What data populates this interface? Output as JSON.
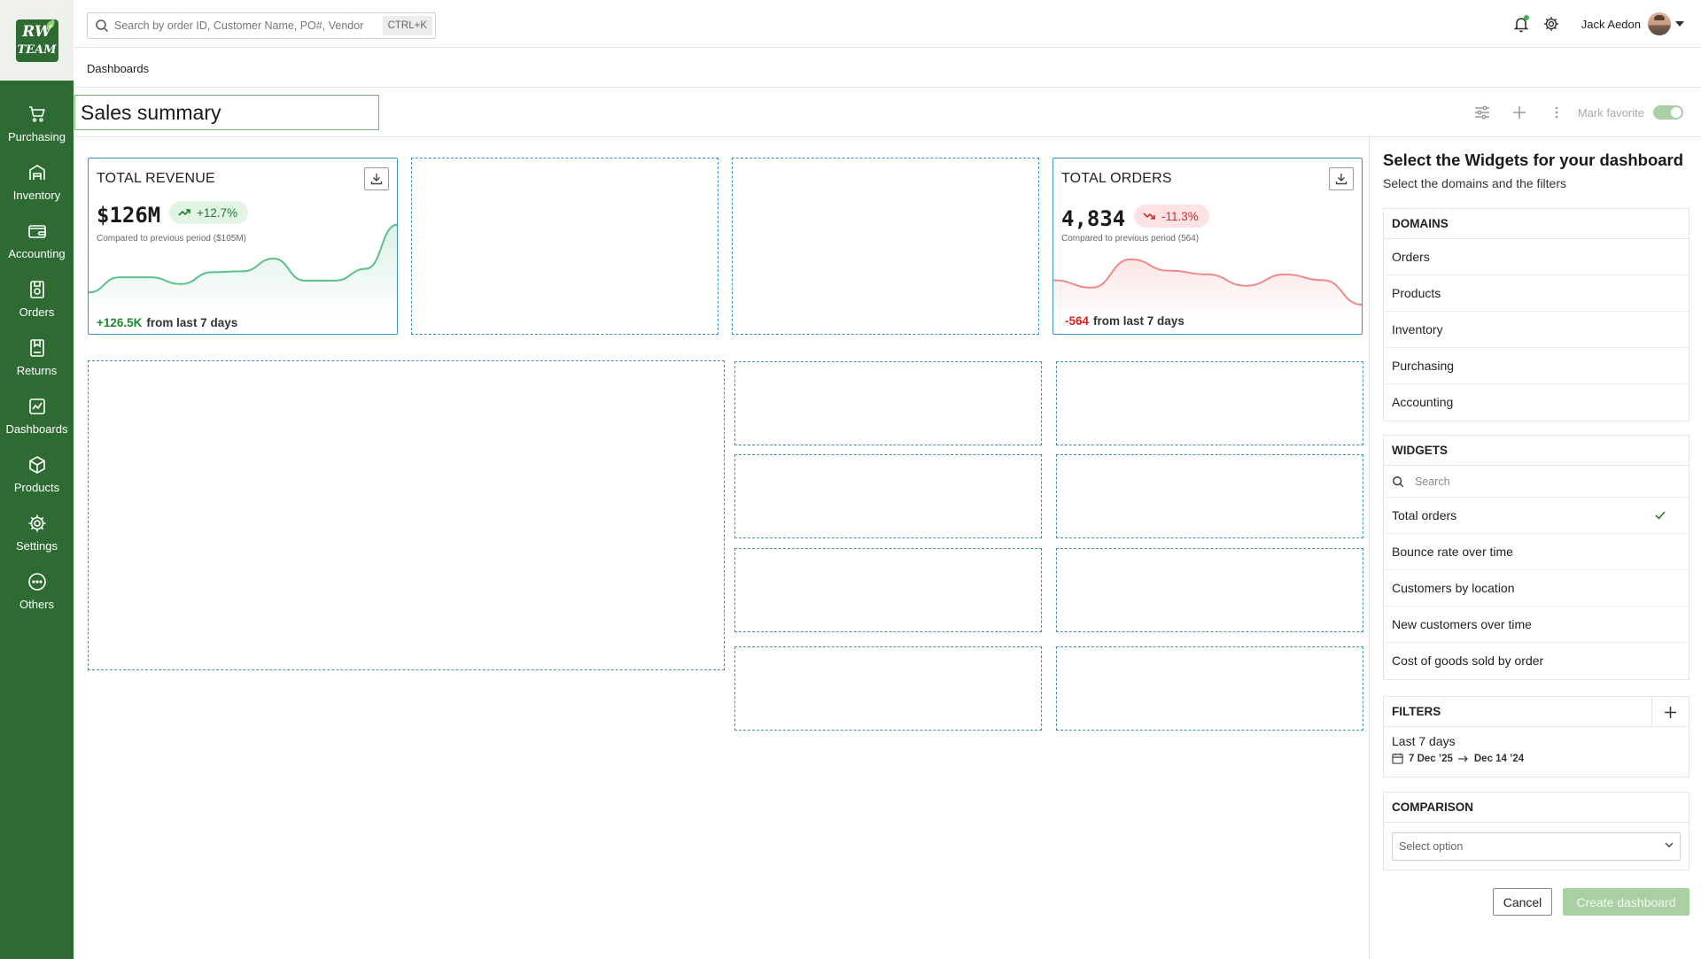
{
  "colors": {
    "sidebar": "#2e6b33",
    "accent": "#3b8fc6",
    "positive": "#1a8a32",
    "negative": "#e02020",
    "primary_disabled": "#a9cfa3"
  },
  "logo": {
    "line1": "RW",
    "line2": "TEAM"
  },
  "nav": [
    {
      "label": "Purchasing",
      "icon": "cart-icon"
    },
    {
      "label": "Inventory",
      "icon": "warehouse-icon"
    },
    {
      "label": "Accounting",
      "icon": "wallet-icon"
    },
    {
      "label": "Orders",
      "icon": "orders-icon"
    },
    {
      "label": "Returns",
      "icon": "returns-icon"
    },
    {
      "label": "Dashboards",
      "icon": "chart-icon"
    },
    {
      "label": "Products",
      "icon": "box-icon"
    },
    {
      "label": "Settings",
      "icon": "gear-icon"
    },
    {
      "label": "Others",
      "icon": "more-icon"
    }
  ],
  "topbar": {
    "search_placeholder": "Search by order ID, Customer Name, PO#, Vendor",
    "shortcut": "CTRL+K",
    "user_name": "Jack Aedon"
  },
  "breadcrumb": "Dashboards",
  "dashboard": {
    "title": "Sales summary",
    "mark_favorite_label": "Mark favorite",
    "mark_favorite_on": true
  },
  "widgets": {
    "revenue": {
      "title": "TOTAL REVENUE",
      "value": "$126M",
      "change": "+12.7%",
      "compare": "Compared to previous period ($105M)",
      "delta": "+126.5K",
      "delta_text": "from last 7 days",
      "trend": [
        30,
        48,
        48,
        40,
        54,
        55,
        70,
        44,
        44,
        58,
        110
      ]
    },
    "orders": {
      "title": "TOTAL ORDERS",
      "value": "4,834",
      "change": "-11.3%",
      "compare": "Compared to previous period (564)",
      "delta": "-564",
      "delta_text": "from last 7 days",
      "trend": [
        40,
        32,
        62,
        50,
        46,
        34,
        46,
        40,
        14
      ]
    }
  },
  "panel": {
    "title": "Select the Widgets for your dashboard",
    "subtitle": "Select the domains and the filters",
    "domains_header": "DOMAINS",
    "domains": [
      "Orders",
      "Products",
      "Inventory",
      "Purchasing",
      "Accounting"
    ],
    "widgets_header": "WIDGETS",
    "widgets_search_placeholder": "Search",
    "widget_list": [
      {
        "label": "Total orders",
        "checked": true
      },
      {
        "label": "Bounce rate over time",
        "checked": false
      },
      {
        "label": "Customers by location",
        "checked": false
      },
      {
        "label": "New customers over time",
        "checked": false
      },
      {
        "label": "Cost of goods sold by  order",
        "checked": false
      }
    ],
    "filters_header": "FILTERS",
    "filter": {
      "name": "Last 7 days",
      "from": "7 Dec ’25",
      "to": "Dec 14 ’24"
    },
    "comparison_header": "COMPARISON",
    "comparison_placeholder": "Select option",
    "cancel_label": "Cancel",
    "create_label": "Create dashboard"
  }
}
